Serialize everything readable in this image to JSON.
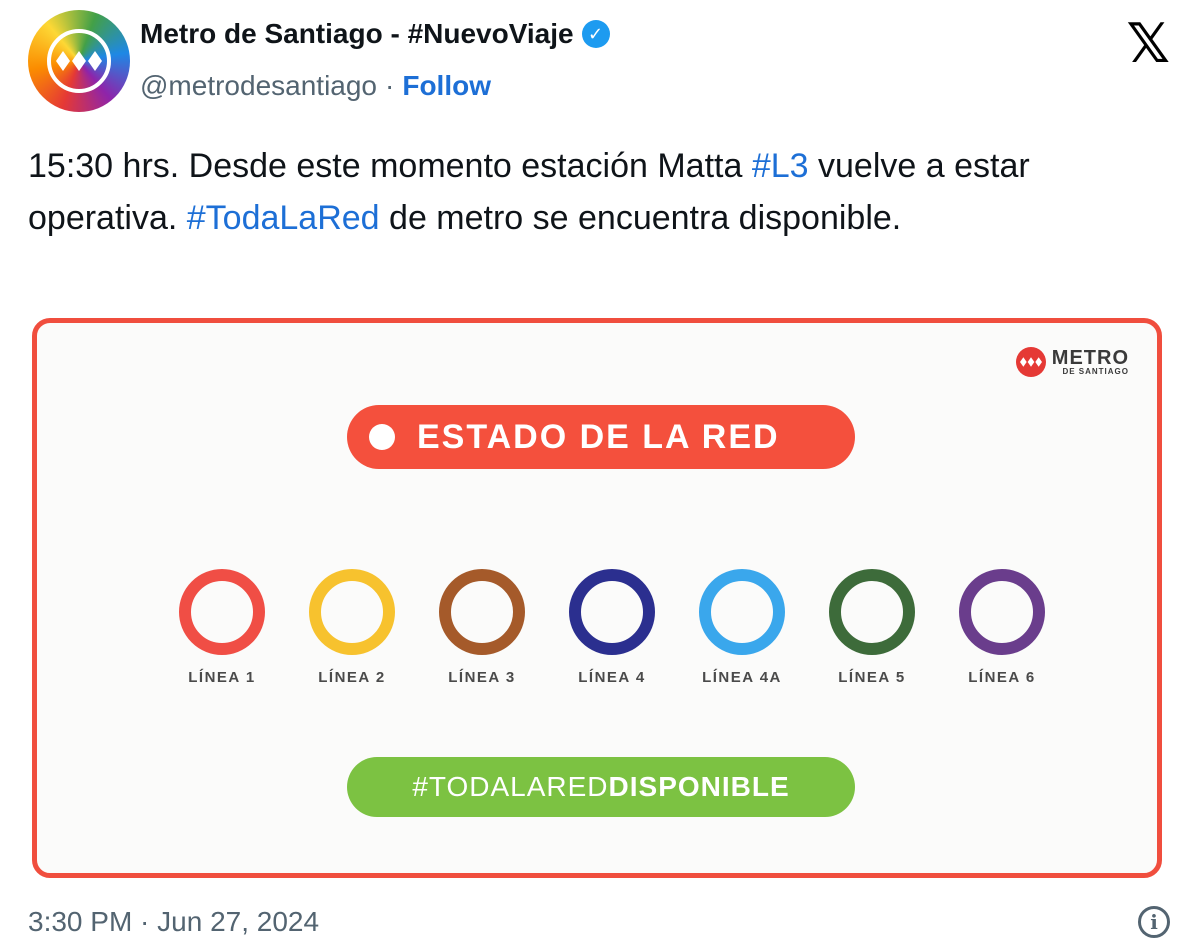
{
  "header": {
    "display_name": "Metro de Santiago - #NuevoViaje",
    "handle": "@metrodesantiago",
    "separator": "·",
    "follow_label": "Follow",
    "x_logo": "𝕏"
  },
  "tweet": {
    "text_1": "15:30 hrs. Desde este momento estación Matta ",
    "hashtag_1": "#L3",
    "text_2": " vuelve a estar operativa. ",
    "hashtag_2": "#TodaLaRed",
    "text_3": " de metro se encuentra disponible."
  },
  "media": {
    "logo_word": "METRO",
    "logo_sub": "DE SANTIAGO",
    "estado_label": "ESTADO DE LA RED",
    "lines": [
      {
        "label": "LÍNEA 1",
        "color": "#f04e45"
      },
      {
        "label": "LÍNEA 2",
        "color": "#f7c22e"
      },
      {
        "label": "LÍNEA 3",
        "color": "#a55a2a"
      },
      {
        "label": "LÍNEA 4",
        "color": "#2b2f8f"
      },
      {
        "label": "LÍNEA 4A",
        "color": "#3aa7ec"
      },
      {
        "label": "LÍNEA 5",
        "color": "#3d6b3a"
      },
      {
        "label": "LÍNEA 6",
        "color": "#6a3d8c"
      }
    ],
    "disponible_prefix": "#TODALARED",
    "disponible_suffix": "DISPONIBLE"
  },
  "footer": {
    "timestamp": "3:30 PM · Jun 27, 2024",
    "info_icon": "i"
  },
  "colors": {
    "link": "#1d6fd6",
    "verified": "#1d9bf0",
    "media_border": "#f04e3e",
    "estado_pill": "#f4503d",
    "disponible_pill": "#7cc242"
  }
}
